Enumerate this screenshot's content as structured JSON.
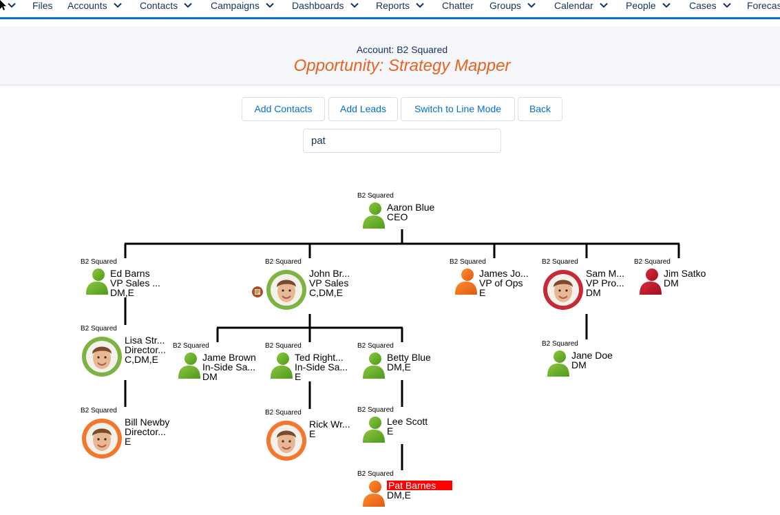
{
  "nav": {
    "items": [
      {
        "label": "Files",
        "chevron": false
      },
      {
        "label": "Accounts",
        "chevron": true
      },
      {
        "label": "Contacts",
        "chevron": true
      },
      {
        "label": "Campaigns",
        "chevron": true
      },
      {
        "label": "Dashboards",
        "chevron": true
      },
      {
        "label": "Reports",
        "chevron": true
      },
      {
        "label": "Chatter",
        "chevron": false
      },
      {
        "label": "Groups",
        "chevron": true
      },
      {
        "label": "Calendar",
        "chevron": true
      },
      {
        "label": "People",
        "chevron": true
      },
      {
        "label": "Cases",
        "chevron": true
      },
      {
        "label": "Forecast",
        "chevron": false
      }
    ]
  },
  "header": {
    "account_line": "Account: B2 Squared",
    "title": "Opportunity: Strategy Mapper"
  },
  "toolbar": {
    "add_contacts": "Add Contacts",
    "add_leads": "Add Leads",
    "switch_mode": "Switch to Line Mode",
    "back": "Back"
  },
  "search": {
    "value": "pat"
  },
  "colors": {
    "green": "#7cb342",
    "orange": "#f5762a",
    "red": "#c62a38",
    "accent": "#0070d2",
    "title_orange": "#e86222",
    "highlight": "#ff0000"
  },
  "contacts": [
    {
      "id": "aaron",
      "company": "B2 Squared",
      "name": "Aaron Blue",
      "title": "CEO",
      "role": "",
      "color": "green",
      "photo": false
    },
    {
      "id": "ed",
      "company": "B2 Squared",
      "name": "Ed Barns",
      "title": "VP Sales ...",
      "role": "DM,E",
      "color": "green",
      "photo": false
    },
    {
      "id": "john",
      "company": "B2 Squared",
      "name": "John Br...",
      "title": "VP Sales",
      "role": "C,DM,E",
      "color": "green",
      "photo": true,
      "note": true
    },
    {
      "id": "james",
      "company": "B2 Squared",
      "name": "James Jo...",
      "title": "VP of Ops",
      "role": "E",
      "color": "orange",
      "photo": false
    },
    {
      "id": "sam",
      "company": "B2 Squared",
      "name": "Sam M...",
      "title": "VP Pro...",
      "role": "DM",
      "color": "red",
      "photo": true
    },
    {
      "id": "jim",
      "company": "B2 Squared",
      "name": "Jim Satko",
      "title": "DM",
      "role": "",
      "color": "red",
      "photo": false
    },
    {
      "id": "lisa",
      "company": "B2 Squared",
      "name": "Lisa Str...",
      "title": "Director...",
      "role": "C,DM,E",
      "color": "green",
      "photo": true
    },
    {
      "id": "jame",
      "company": "B2 Squared",
      "name": "Jame Brown",
      "title": "In-Side Sa...",
      "role": "DM",
      "color": "green",
      "photo": false
    },
    {
      "id": "ted",
      "company": "B2 Squared",
      "name": "Ted Right...",
      "title": "In-Side Sa...",
      "role": "E",
      "color": "green",
      "photo": false
    },
    {
      "id": "betty",
      "company": "B2 Squared",
      "name": "Betty Blue",
      "title": "DM,E",
      "role": "",
      "color": "green",
      "photo": false
    },
    {
      "id": "jane",
      "company": "B2 Squared",
      "name": "Jane Doe",
      "title": "DM",
      "role": "",
      "color": "green",
      "photo": false
    },
    {
      "id": "bill",
      "company": "B2 Squared",
      "name": "Bill Newby",
      "title": "Director...",
      "role": "E",
      "color": "orange",
      "photo": true
    },
    {
      "id": "rick",
      "company": "B2 Squared",
      "name": "Rick Wr...",
      "title": "E",
      "role": "",
      "color": "orange",
      "photo": true
    },
    {
      "id": "lee",
      "company": "B2 Squared",
      "name": "Lee Scott",
      "title": "E",
      "role": "",
      "color": "green",
      "photo": false
    },
    {
      "id": "pat",
      "company": "B2 Squared",
      "name": "Pat Barnes",
      "title": "DM,E",
      "role": "",
      "color": "orange",
      "photo": false,
      "highlighted": true
    }
  ]
}
